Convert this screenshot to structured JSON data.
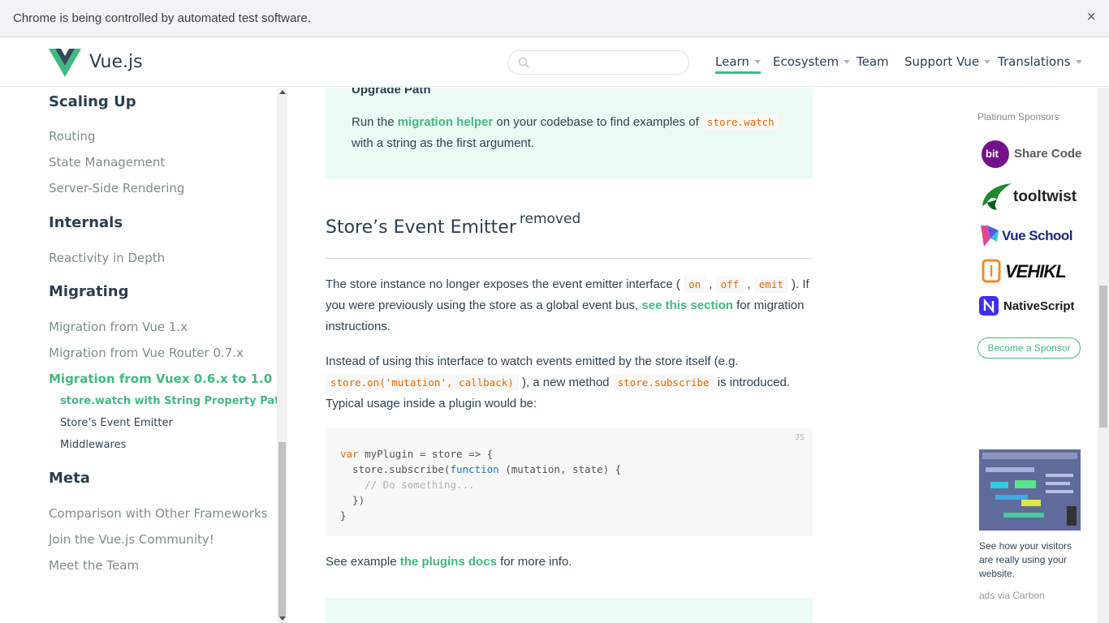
{
  "automation_bar": {
    "message": "Chrome is being controlled by automated test software.",
    "close": "×"
  },
  "header": {
    "brand": "Vue.js",
    "search_placeholder": "",
    "nav": [
      {
        "label": "Learn",
        "dropdown": true,
        "active": true
      },
      {
        "label": "Ecosystem",
        "dropdown": true
      },
      {
        "label": "Team",
        "dropdown": false
      },
      {
        "label": "Support Vue",
        "dropdown": true
      },
      {
        "label": "Translations",
        "dropdown": true
      }
    ]
  },
  "sidebar": {
    "sections": [
      {
        "title": "Scaling Up",
        "items": [
          "Routing",
          "State Management",
          "Server-Side Rendering"
        ]
      },
      {
        "title": "Internals",
        "items": [
          "Reactivity in Depth"
        ]
      },
      {
        "title": "Migrating",
        "items": [
          "Migration from Vue 1.x",
          "Migration from Vue Router 0.7.x",
          "Migration from Vuex 0.6.x to 1.0"
        ],
        "subitems": [
          "store.watch with String Property Path",
          "Store’s Event Emitter",
          "Middlewares"
        ]
      },
      {
        "title": "Meta",
        "items": [
          "Comparison with Other Frameworks",
          "Join the Vue.js Community!",
          "Meet the Team"
        ]
      }
    ]
  },
  "content": {
    "tip": {
      "title": "Upgrade Path",
      "text_before": "Run the ",
      "link": "migration helper",
      "text_mid": " on your codebase to find examples of ",
      "code": "store.watch",
      "text_after": " with a string as the first argument."
    },
    "heading": "Store’s Event Emitter",
    "heading_badge": "removed",
    "para1": {
      "t1": "The store instance no longer exposes the event emitter interface ( ",
      "c1": "on",
      "sep1": " , ",
      "c2": "off",
      "sep2": " , ",
      "c3": "emit",
      "t2": " ). If you were previously using the store as a global event bus, ",
      "link": "see this section",
      "t3": " for migration instructions."
    },
    "para2": {
      "t1": "Instead of using this interface to watch events emitted by the store itself (e.g. ",
      "c1": "store.on('mutation', callback)",
      "t2": " ), a new method ",
      "c2": "store.subscribe",
      "t3": " is introduced. Typical usage inside a plugin would be:"
    },
    "code_lang": "JS",
    "code_lines": [
      {
        "kw": "var",
        "rest": " myPlugin = store => {"
      },
      {
        "pre": "  store.subscribe(",
        "fn": "function",
        "rest": " (mutation, state) {"
      },
      {
        "comment": "    // Do something..."
      },
      {
        "plain": "  })"
      },
      {
        "plain": "}"
      }
    ],
    "para3": {
      "t1": "See example ",
      "link": "the plugins docs",
      "t2": " for more info."
    }
  },
  "sponsors": {
    "title": "Platinum Sponsors",
    "items": [
      "Share Code",
      "tooltwist",
      "Vue School",
      "VEHIKL",
      "NativeScript"
    ],
    "bit_label": "bit",
    "become": "Become a Sponsor",
    "ad_text": "See how your visitors are really using your website.",
    "ad_by": "ads via Carbon"
  },
  "colors": {
    "accent": "#42b983",
    "code": "#e96900",
    "tip_bg": "#ebfaf2"
  }
}
